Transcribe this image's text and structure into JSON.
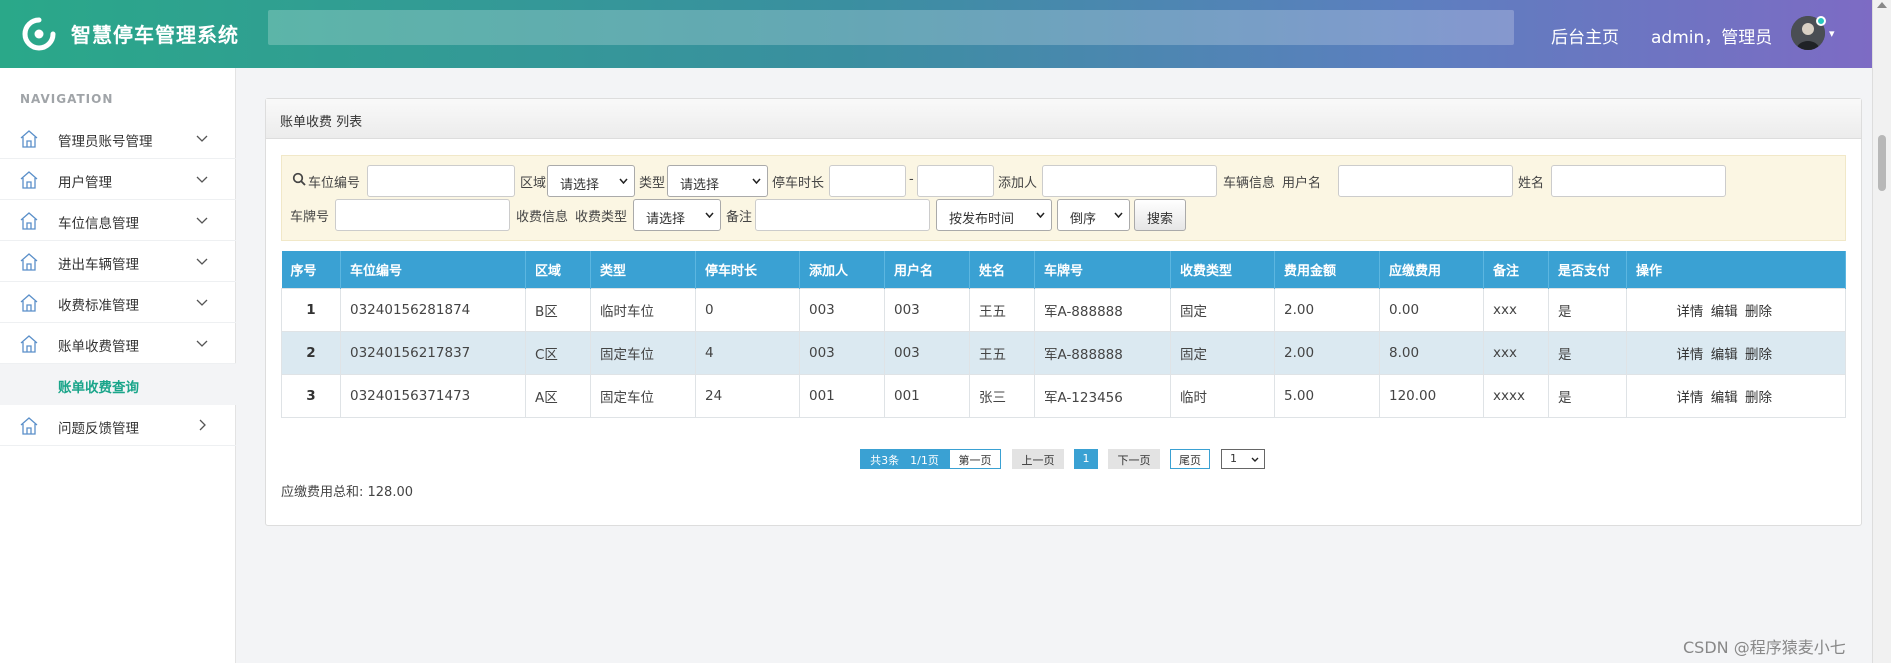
{
  "header": {
    "app_title": "智慧停车管理系统",
    "home_link": "后台主页",
    "user_text": "admin，管理员"
  },
  "sidebar": {
    "nav_title": "NAVIGATION",
    "items": [
      {
        "label": "管理员账号管理"
      },
      {
        "label": "用户管理"
      },
      {
        "label": "车位信息管理"
      },
      {
        "label": "进出车辆管理"
      },
      {
        "label": "收费标准管理"
      },
      {
        "label": "账单收费管理"
      },
      {
        "label": "问题反馈管理"
      }
    ],
    "submenu": {
      "label": "账单收费查询"
    }
  },
  "panel": {
    "title": "账单收费 列表"
  },
  "filters": {
    "space_no_label": "车位编号",
    "area_label": "区域",
    "area_select": "请选择",
    "type_label": "类型",
    "type_select": "请选择",
    "duration_label": "停车时长",
    "duration_sep": "-",
    "adder_label": "添加人",
    "vehicle_info_label": "车辆信息",
    "username_label": "用户名",
    "name_label": "姓名",
    "plate_label": "车牌号",
    "charge_info_label": "收费信息",
    "charge_type_label": "收费类型",
    "charge_type_select": "请选择",
    "remark_label": "备注",
    "sort_select": "按发布时间",
    "order_select": "倒序",
    "search_button": "搜索"
  },
  "table": {
    "headers": [
      "序号",
      "车位编号",
      "区域",
      "类型",
      "停车时长",
      "添加人",
      "用户名",
      "姓名",
      "车牌号",
      "收费类型",
      "费用金额",
      "应缴费用",
      "备注",
      "是否支付",
      "操作"
    ],
    "rows": [
      {
        "idx": "1",
        "space_no": "03240156281874",
        "area": "B区",
        "type": "临时车位",
        "duration": "0",
        "adder": "003",
        "username": "003",
        "name": "王五",
        "plate": "军A-888888",
        "charge_type": "固定",
        "amount": "2.00",
        "due": "0.00",
        "remark": "xxx",
        "paid": "是"
      },
      {
        "idx": "2",
        "space_no": "03240156217837",
        "area": "C区",
        "type": "固定车位",
        "duration": "4",
        "adder": "003",
        "username": "003",
        "name": "王五",
        "plate": "军A-888888",
        "charge_type": "固定",
        "amount": "2.00",
        "due": "8.00",
        "remark": "xxx",
        "paid": "是"
      },
      {
        "idx": "3",
        "space_no": "03240156371473",
        "area": "A区",
        "type": "固定车位",
        "duration": "24",
        "adder": "001",
        "username": "001",
        "name": "张三",
        "plate": "军A-123456",
        "charge_type": "临时",
        "amount": "5.00",
        "due": "120.00",
        "remark": "xxxx",
        "paid": "是"
      }
    ],
    "ops": {
      "detail": "详情",
      "edit": "编辑",
      "delete": "删除"
    }
  },
  "pagination": {
    "info": "共3条　1/1页",
    "first": "第一页",
    "prev": "上一页",
    "current": "1",
    "next": "下一页",
    "last": "尾页",
    "page_select": "1"
  },
  "summary": {
    "total_text": "应缴费用总和: 128.00"
  },
  "watermark": "CSDN @程序猿麦小七"
}
